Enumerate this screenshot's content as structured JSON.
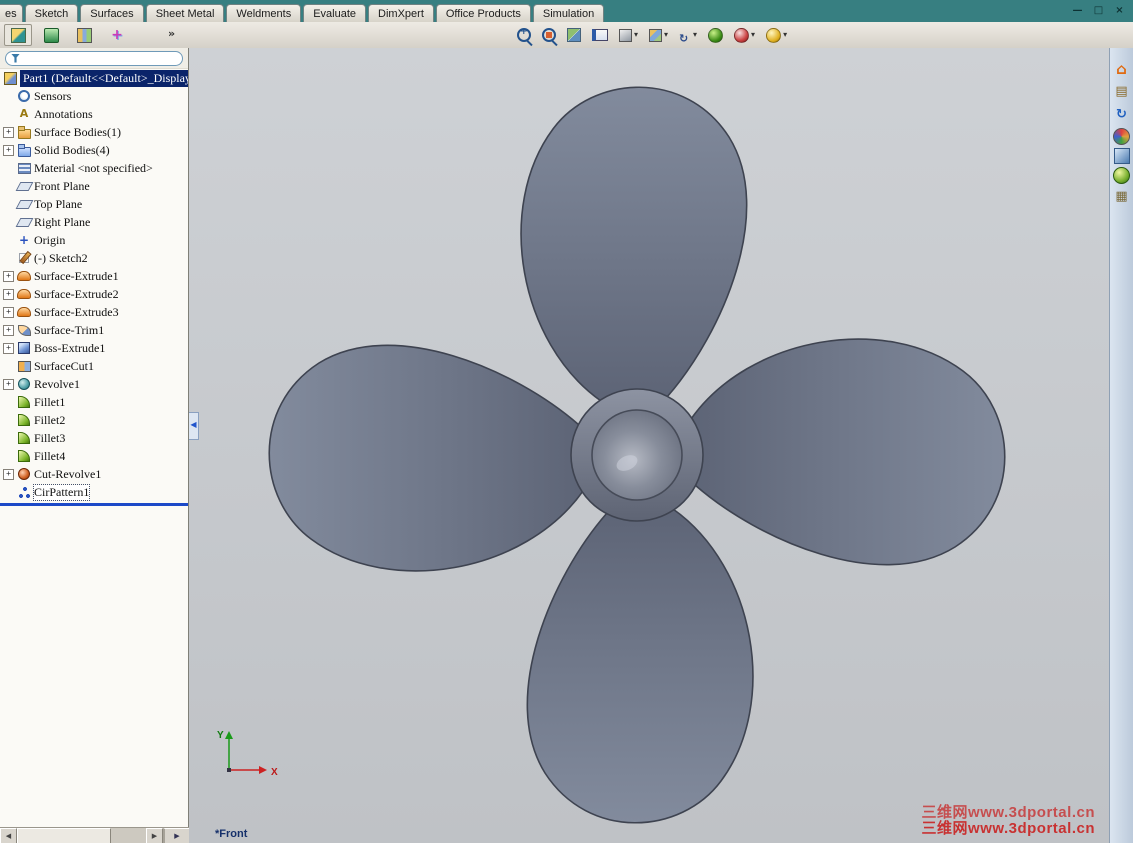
{
  "command_tabs": {
    "items": [
      {
        "label": "es"
      },
      {
        "label": "Sketch"
      },
      {
        "label": "Surfaces"
      },
      {
        "label": "Sheet Metal"
      },
      {
        "label": "Weldments"
      },
      {
        "label": "Evaluate"
      },
      {
        "label": "DimXpert"
      },
      {
        "label": "Office Products"
      },
      {
        "label": "Simulation"
      }
    ]
  },
  "window_controls": {
    "minimize": "—",
    "restore": "□",
    "close": "×"
  },
  "panel_tabs": {
    "items": [
      {
        "name": "featuremanager-design-tree"
      },
      {
        "name": "propertymanager"
      },
      {
        "name": "configurationmanager"
      },
      {
        "name": "dimxpertmanager"
      }
    ],
    "overflow_chevron": "»"
  },
  "view_toolbar": {
    "caret_glyph": "▾",
    "items": [
      {
        "name": "zoom-to-area",
        "caret": false
      },
      {
        "name": "zoom-to-fit",
        "caret": false
      },
      {
        "name": "section-view",
        "caret": false
      },
      {
        "name": "hide-show-items",
        "caret": false
      },
      {
        "name": "display-style",
        "caret": true
      },
      {
        "name": "view-orientation",
        "caret": true
      },
      {
        "name": "rotate-view",
        "caret": true
      },
      {
        "name": "edit-appearance",
        "caret": false
      },
      {
        "name": "apply-scene",
        "caret": true
      },
      {
        "name": "view-settings",
        "caret": true
      }
    ]
  },
  "feature_tree": {
    "expand_glyph": "+",
    "root_label": "Part1  (Default<<Default>_Display",
    "items": [
      {
        "label": "Sensors",
        "icon": "sensors",
        "expandable": false
      },
      {
        "label": "Annotations",
        "icon": "annotations",
        "expandable": false
      },
      {
        "label": "Surface Bodies(1)",
        "icon": "folder-surf",
        "expandable": true
      },
      {
        "label": "Solid Bodies(4)",
        "icon": "folder-solid",
        "expandable": true
      },
      {
        "label": "Material <not specified>",
        "icon": "material",
        "expandable": false
      },
      {
        "label": "Front Plane",
        "icon": "plane",
        "expandable": false
      },
      {
        "label": "Top Plane",
        "icon": "plane",
        "expandable": false
      },
      {
        "label": "Right Plane",
        "icon": "plane",
        "expandable": false
      },
      {
        "label": "Origin",
        "icon": "origin",
        "expandable": false
      },
      {
        "label": "(-) Sketch2",
        "icon": "sketch",
        "expandable": false
      },
      {
        "label": "Surface-Extrude1",
        "icon": "surfext",
        "expandable": true
      },
      {
        "label": "Surface-Extrude2",
        "icon": "surfext",
        "expandable": true
      },
      {
        "label": "Surface-Extrude3",
        "icon": "surfext",
        "expandable": true
      },
      {
        "label": "Surface-Trim1",
        "icon": "surftrim",
        "expandable": true
      },
      {
        "label": "Boss-Extrude1",
        "icon": "boss",
        "expandable": true
      },
      {
        "label": "SurfaceCut1",
        "icon": "surfcut",
        "expandable": false
      },
      {
        "label": "Revolve1",
        "icon": "revolve",
        "expandable": true
      },
      {
        "label": "Fillet1",
        "icon": "fillet",
        "expandable": false
      },
      {
        "label": "Fillet2",
        "icon": "fillet",
        "expandable": false
      },
      {
        "label": "Fillet3",
        "icon": "fillet",
        "expandable": false
      },
      {
        "label": "Fillet4",
        "icon": "fillet",
        "expandable": false
      },
      {
        "label": "Cut-Revolve1",
        "icon": "cutrev",
        "expandable": true
      },
      {
        "label": "CirPattern1",
        "icon": "cirpat",
        "expandable": false,
        "selected": true
      }
    ]
  },
  "viewport": {
    "view_label": "*Front",
    "triad": {
      "x_label": "X",
      "y_label": "Y"
    }
  },
  "watermark": {
    "text": "三维网www.3dportal.cn"
  },
  "task_pane": {
    "items": [
      {
        "name": "home"
      },
      {
        "name": "design-library"
      },
      {
        "name": "file-explorer"
      },
      {
        "name": "view-palette"
      },
      {
        "name": "appearances"
      },
      {
        "name": "scenes"
      },
      {
        "name": "custom-properties"
      }
    ]
  },
  "scrollbar": {
    "left_arrow": "◀",
    "right_arrow": "▶",
    "corner_arrow": "▶"
  },
  "splitter": {
    "collapse_arrow": "◀"
  },
  "colors": {
    "titlebar": "#377f81",
    "selection": "#0a246a",
    "rollback": "#1c49c8",
    "watermark": "#c83232",
    "blade_fill": "#6e7688",
    "blade_outline": "#3e4350"
  }
}
